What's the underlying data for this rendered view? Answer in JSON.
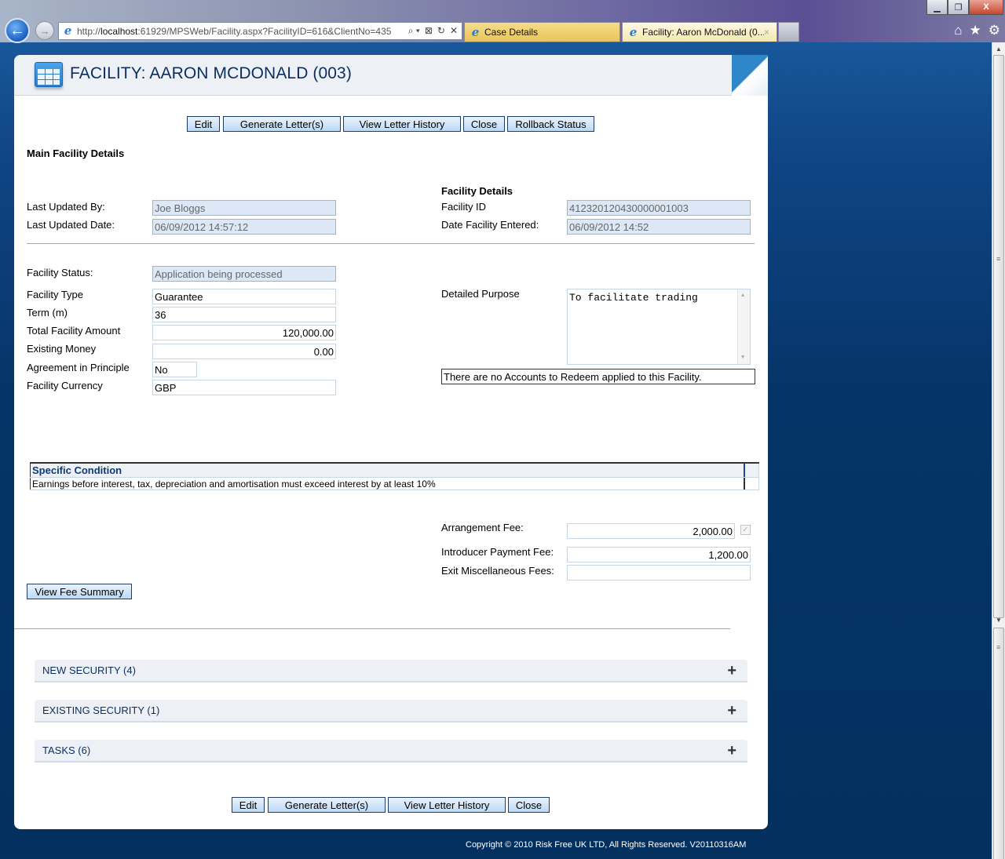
{
  "browser": {
    "url_prefix": "http://",
    "url_host": "localhost",
    "url_rest": ":61929/MPSWeb/Facility.aspx?FacilityID=616&ClientNo=435",
    "window_controls": {
      "minimize": "▁",
      "restore": "❐",
      "close": "X"
    },
    "tabs": [
      {
        "label": "Case Details",
        "icon": "ie-icon"
      },
      {
        "label": "Facility: Aaron McDonald (0...",
        "icon": "ie-icon",
        "close": "×"
      }
    ],
    "toolbar_icons": {
      "home": "⌂",
      "favorites": "★",
      "tools": "⚙"
    },
    "address_tools": {
      "search": "⌕ ▾",
      "compat": "⊠",
      "refresh": "↻",
      "stop": "✕"
    }
  },
  "page": {
    "title": "FACILITY: AARON MCDONALD (003)",
    "top_actions": [
      "Edit",
      "Generate Letter(s)",
      "View Letter History",
      "Close",
      "Rollback Status"
    ],
    "bottom_actions": [
      "Edit",
      "Generate Letter(s)",
      "View Letter History",
      "Close"
    ],
    "main_section_title": "Main Facility Details",
    "audit": {
      "last_updated_by_label": "Last Updated By:",
      "last_updated_by": "Joe Bloggs",
      "last_updated_date_label": "Last Updated Date:",
      "last_updated_date": "06/09/2012 14:57:12"
    },
    "facility_details": {
      "title": "Facility Details",
      "facility_id_label": "Facility ID",
      "facility_id": "412320120430000001003",
      "date_entered_label": "Date Facility Entered:",
      "date_entered": "06/09/2012 14:52"
    },
    "facility": {
      "status_label": "Facility Status:",
      "status": "Application being processed",
      "type_label": "Facility Type",
      "type": "Guarantee",
      "term_label": "Term (m)",
      "term": "36",
      "total_amount_label": "Total Facility Amount",
      "total_amount": "120,000.00",
      "existing_money_label": "Existing Money",
      "existing_money": "0.00",
      "aip_label": "Agreement in Principle",
      "aip": "No",
      "currency_label": "Facility Currency",
      "currency": "GBP",
      "purpose_label": "Detailed Purpose",
      "purpose": "To facilitate trading",
      "redeem_notice": "There are no Accounts to Redeem applied to this Facility."
    },
    "conditions": {
      "header": "Specific Condition",
      "rows": [
        "Earnings before interest, tax, depreciation and amortisation must exceed interest by at least 10%"
      ]
    },
    "fees": {
      "arrangement_label": "Arrangement Fee:",
      "arrangement": "2,000.00",
      "arrangement_checked": true,
      "introducer_label": "Introducer Payment Fee:",
      "introducer": "1,200.00",
      "exit_misc_label": "Exit Miscellaneous Fees:",
      "exit_misc": "",
      "view_summary": "View Fee Summary"
    },
    "sections": [
      {
        "label": "NEW SECURITY (4)",
        "expand": "+"
      },
      {
        "label": "EXISTING SECURITY (1)",
        "expand": "+"
      },
      {
        "label": "TASKS (6)",
        "expand": "+"
      }
    ]
  },
  "footer": {
    "copyright": "Copyright © 2010 Risk Free UK LTD, All Rights Reserved. V20110316AM"
  }
}
